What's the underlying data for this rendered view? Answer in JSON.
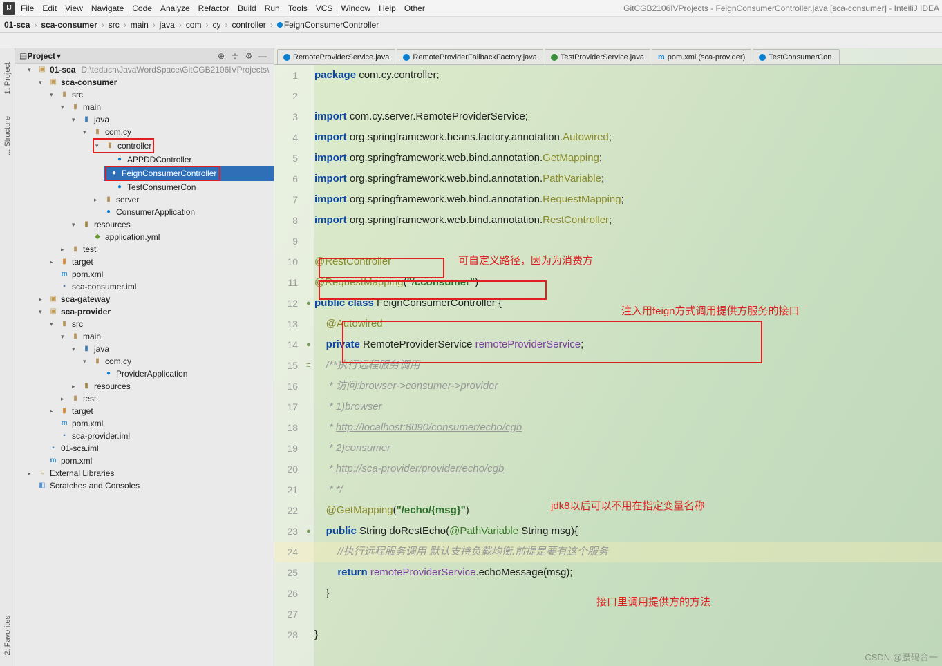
{
  "title": {
    "project_ctx": "GitCGB2106IVProjects - FeignConsumerController.java [sca-consumer] - IntelliJ IDEA"
  },
  "menu": {
    "items": [
      {
        "k": "F",
        "rest": "ile"
      },
      {
        "k": "E",
        "rest": "dit"
      },
      {
        "k": "V",
        "rest": "iew"
      },
      {
        "k": "N",
        "rest": "avigate"
      },
      {
        "k": "C",
        "rest": "ode"
      },
      {
        "k": "",
        "rest": "Analyze"
      },
      {
        "k": "R",
        "rest": "efactor"
      },
      {
        "k": "B",
        "rest": "uild"
      },
      {
        "k": "",
        "rest": "Run"
      },
      {
        "k": "T",
        "rest": "ools"
      },
      {
        "k": "",
        "rest": "VCS"
      },
      {
        "k": "W",
        "rest": "indow"
      },
      {
        "k": "H",
        "rest": "elp"
      },
      {
        "k": "",
        "rest": "Other"
      }
    ]
  },
  "crumbs": [
    "01-sca",
    "sca-consumer",
    "src",
    "main",
    "java",
    "com",
    "cy",
    "controller",
    "FeignConsumerController"
  ],
  "pane": {
    "title": "Project"
  },
  "vtabs": {
    "project": "1: Project",
    "structure": "..: Structure",
    "fav": "2: Favorites"
  },
  "tree": {
    "root": "01-sca",
    "root_path": "D:\\teducn\\JavaWordSpace\\GitCGB2106IVProjects\\",
    "consumer": "sca-consumer",
    "src": "src",
    "main": "main",
    "java": "java",
    "comcy": "com.cy",
    "controller": "controller",
    "appdd": "APPDDController",
    "feign": "FeignConsumerController",
    "testcon": "TestConsumerCon",
    "server": "server",
    "app": "ConsumerApplication",
    "resources": "resources",
    "yml": "application.yml",
    "test": "test",
    "target": "target",
    "pom": "pom.xml",
    "iml": "sca-consumer.iml",
    "gateway": "sca-gateway",
    "provider": "sca-provider",
    "papp": "ProviderApplication",
    "piml": "sca-provider.iml",
    "sca_iml": "01-sca.iml",
    "ext": "External Libraries",
    "scratch": "Scratches and Consoles"
  },
  "tabs": [
    {
      "icon": "c",
      "label": "RemoteProviderService.java"
    },
    {
      "icon": "c",
      "label": "RemoteProviderFallbackFactory.java"
    },
    {
      "icon": "i",
      "label": "TestProviderService.java"
    },
    {
      "icon": "m",
      "label": "pom.xml (sca-provider)"
    },
    {
      "icon": "c",
      "label": "TestConsumerCon."
    }
  ],
  "code": {
    "pkg": "package ",
    "pkgv": "com.cy.controller;",
    "imp": "import ",
    "i1": "com.cy.server.RemoteProviderService;",
    "i2a": "org.springframework.beans.factory.annotation.",
    "i2b": "Autowired",
    "sc": ";",
    "i3a": "org.springframework.web.bind.annotation.",
    "i3b": "GetMapping",
    "i4b": "PathVariable",
    "i5b": "RequestMapping",
    "i6b": "RestController",
    "rc": "@RestController",
    "rm": "@RequestMapping",
    "rm_s": "(\"/cconsumer\")",
    "cls": "public class ",
    "clsn": "FeignConsumerController",
    " ob": " {",
    "aw": "@Autowired",
    "pri": "private ",
    "rps": "RemoteProviderService ",
    "fld": "remoteProviderService",
    "c1": "/**执行远程服务调用",
    "c2": " * 访问:browser->consumer->provider",
    "c3": " * 1)browser",
    "c4": " * http://localhost:8090/consumer/echo/cgb",
    "c5": " * 2)consumer",
    "c6": " * http://sca-provider/provider/echo/cgb",
    "c7": " * */",
    "gm": "@GetMapping",
    "gm_s": "(\"/echo/{msg}\")",
    "mhead1": "public ",
    "mret": "String ",
    "mname": "doRestEcho(",
    "pv": "@PathVariable",
    "mrest": " String msg){",
    "mcom": "//执行远程服务调用 默认支持负载均衡.前提是要有这个服务",
    "ret": "return ",
    "retc": ".echoMessage(msg);",
    "cb": "}"
  },
  "ann": {
    "a1": "可自定义路径，因为为消费方",
    "a2": "注入用feign方式调用提供方服务的接口",
    "a3": "jdk8以后可以不用在指定变量名称",
    "a4": "接口里调用提供方的方法"
  },
  "watermark": "CSDN @腰码合一"
}
